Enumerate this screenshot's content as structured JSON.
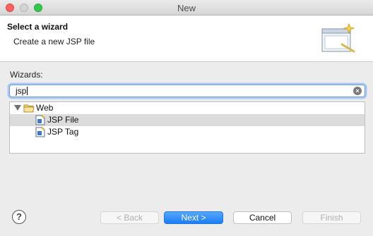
{
  "window": {
    "title": "New"
  },
  "header": {
    "title": "Select a wizard",
    "description": "Create a new JSP file",
    "icon": "wizard-banner-icon"
  },
  "wizards": {
    "label": "Wizards:",
    "filter_value": "jsp",
    "tree": [
      {
        "label": "Web",
        "icon": "folder-icon",
        "expanded": true,
        "depth": 0
      },
      {
        "label": "JSP File",
        "icon": "jsp-file-icon",
        "selected": true,
        "depth": 1
      },
      {
        "label": "JSP Tag",
        "icon": "jsp-tag-icon",
        "selected": false,
        "depth": 1
      }
    ]
  },
  "footer": {
    "help_label": "?",
    "back_label": "< Back",
    "next_label": "Next >",
    "cancel_label": "Cancel",
    "finish_label": "Finish"
  },
  "colors": {
    "accent": "#1b7ef6",
    "focus_ring": "#a9c9f3",
    "selection": "#dcdcdc"
  }
}
